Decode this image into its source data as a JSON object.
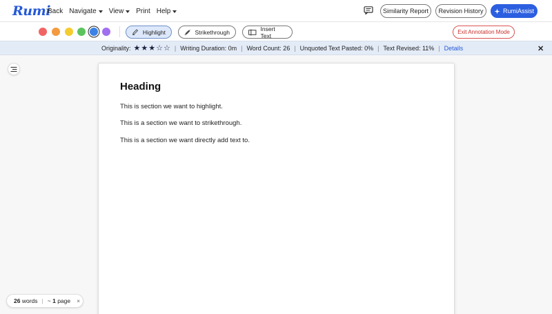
{
  "app": {
    "logo": "Rumi"
  },
  "nav": {
    "back": "Back",
    "navigate": "Navigate",
    "view": "View",
    "print": "Print",
    "help": "Help",
    "comment_icon": "comment-icon",
    "similarity_report": "Similarity Report",
    "revision_history": "Revision History",
    "rumi_assist": "RumiAssist"
  },
  "toolbar": {
    "colors": [
      {
        "name": "red",
        "hex": "#f26464"
      },
      {
        "name": "orange",
        "hex": "#f49a3f"
      },
      {
        "name": "yellow",
        "hex": "#f5cc2f"
      },
      {
        "name": "green",
        "hex": "#5cc45c"
      },
      {
        "name": "blue",
        "hex": "#3b82e6",
        "selected": true
      },
      {
        "name": "purple",
        "hex": "#a070f0"
      }
    ],
    "highlight": "Highlight",
    "strikethrough": "Strikethrough",
    "insert_text": "Insert Text",
    "exit": "Exit Annotation Mode"
  },
  "status": {
    "originality_label": "Originality:",
    "originality_stars": 3,
    "originality_max": 5,
    "writing_duration": "Writing Duration: 0m",
    "word_count": "Word Count: 26",
    "unquoted": "Unquoted Text Pasted: 0%",
    "revised": "Text Revised: 11%",
    "details": "Details"
  },
  "document": {
    "heading": "Heading",
    "paragraphs": [
      "This is section we want to highlight.",
      "This is a section we want to strikethrough.",
      "This is a section we want directly add text to."
    ]
  },
  "footer": {
    "words_count": "26",
    "words_label": "words",
    "page_prefix": "~",
    "page_count": "1",
    "page_label": "page",
    "close": "×"
  },
  "colors": {
    "accent": "#2c5fe0",
    "exit_red": "#c9302c",
    "status_bg": "#e3ebf7"
  }
}
